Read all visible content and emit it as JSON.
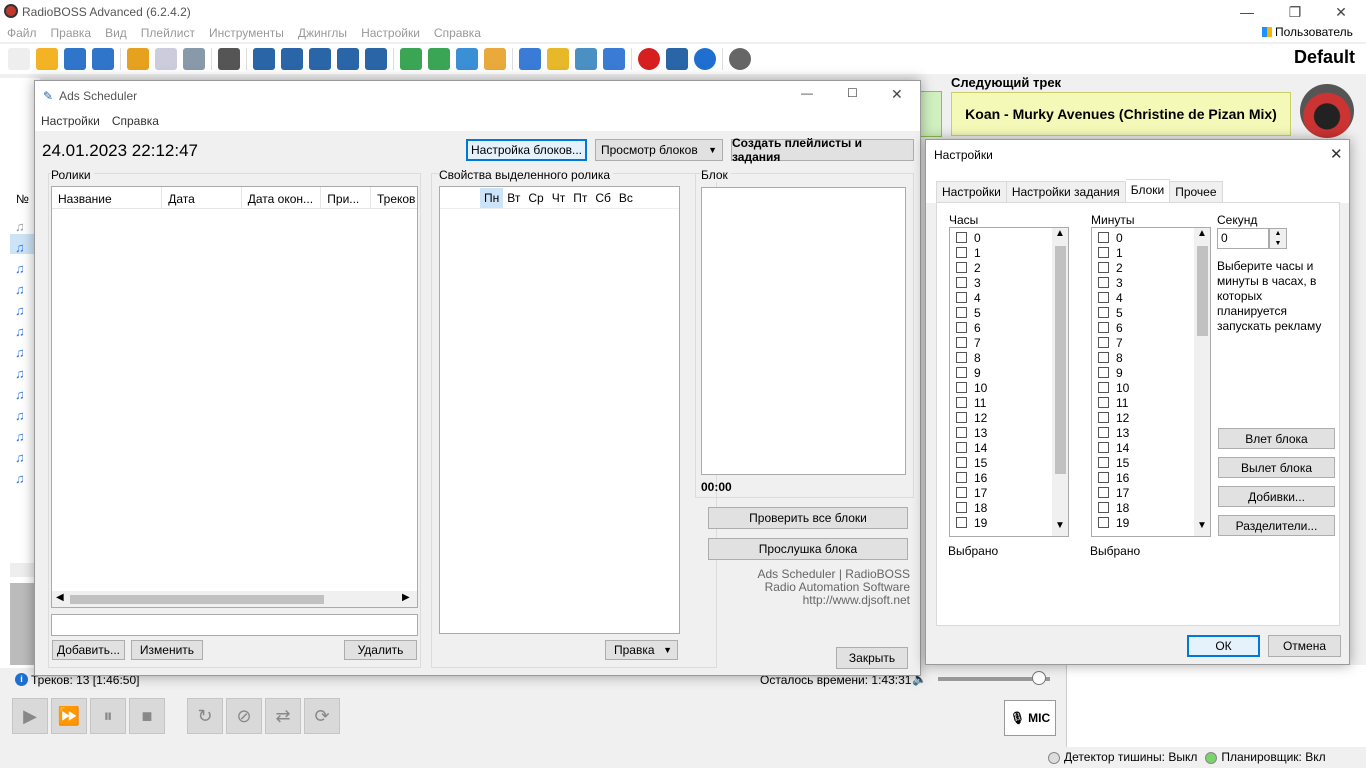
{
  "app": {
    "title": "RadioBOSS Advanced (6.2.4.2)",
    "menu": [
      "Файл",
      "Правка",
      "Вид",
      "Плейлист",
      "Инструменты",
      "Джинглы",
      "Настройки",
      "Справка"
    ],
    "user_label": "Пользователь",
    "profile_name": "Default",
    "next_track_label": "Следующий трек",
    "next_track": "Koan - Murky Avenues (Christine de Pizan Mix)",
    "tracks_count": "Треков: 13 [1:46:50]",
    "time_left": "Осталось времени: 1:43:31",
    "mic_label": "MIC",
    "silence_detector": "Детектор тишины: Выкл",
    "scheduler_status": "Планировщик: Вкл",
    "col_num": "№",
    "volume_fraction": 0.9
  },
  "ads": {
    "title": "Ads Scheduler",
    "menu": [
      "Настройки",
      "Справка"
    ],
    "datetime": "24.01.2023 22:12:47",
    "btn_block_settings": "Настройка блоков...",
    "btn_view_blocks": "Просмотр блоков",
    "btn_create": "Создать плейлисты и задания",
    "clips_label": "Ролики",
    "columns": [
      "Название",
      "Дата начала",
      "Дата окон...",
      "При...",
      "Треков"
    ],
    "props_label": "Свойства выделенного ролика",
    "days": [
      "Пн",
      "Вт",
      "Ср",
      "Чт",
      "Пт",
      "Сб",
      "Вс"
    ],
    "block_label": "Блок",
    "block_time": "00:00",
    "btn_check_all": "Проверить все блоки",
    "btn_listen": "Прослушка блока",
    "credits": [
      "Ads Scheduler | RadioBOSS",
      "Radio Automation Software",
      "http://www.djsoft.net"
    ],
    "btn_add": "Добавить...",
    "btn_edit": "Изменить",
    "btn_delete": "Удалить",
    "btn_edit_menu": "Правка",
    "btn_close": "Закрыть"
  },
  "settings": {
    "title": "Настройки",
    "tabs": [
      "Настройки",
      "Настройки задания",
      "Блоки",
      "Прочее"
    ],
    "active_tab": "Блоки",
    "hours_label": "Часы",
    "minutes_label": "Минуты",
    "seconds_label": "Секунд",
    "seconds_value": "0",
    "hint": "Выберите часы и минуты в часах, в которых планируется запускать рекламу",
    "hours": [
      "0",
      "1",
      "2",
      "3",
      "4",
      "5",
      "6",
      "7",
      "8",
      "9",
      "10",
      "11",
      "12",
      "13",
      "14",
      "15",
      "16",
      "17",
      "18",
      "19"
    ],
    "minutes": [
      "0",
      "1",
      "2",
      "3",
      "4",
      "5",
      "6",
      "7",
      "8",
      "9",
      "10",
      "11",
      "12",
      "13",
      "14",
      "15",
      "16",
      "17",
      "18",
      "19"
    ],
    "selected_label_1": "Выбрано",
    "selected_label_2": "Выбрано",
    "btn_intro": "Влет блока",
    "btn_outro": "Вылет блока",
    "btn_fillers": "Добивки...",
    "btn_separators": "Разделители...",
    "btn_ok": "ОК",
    "btn_cancel": "Отмена"
  }
}
